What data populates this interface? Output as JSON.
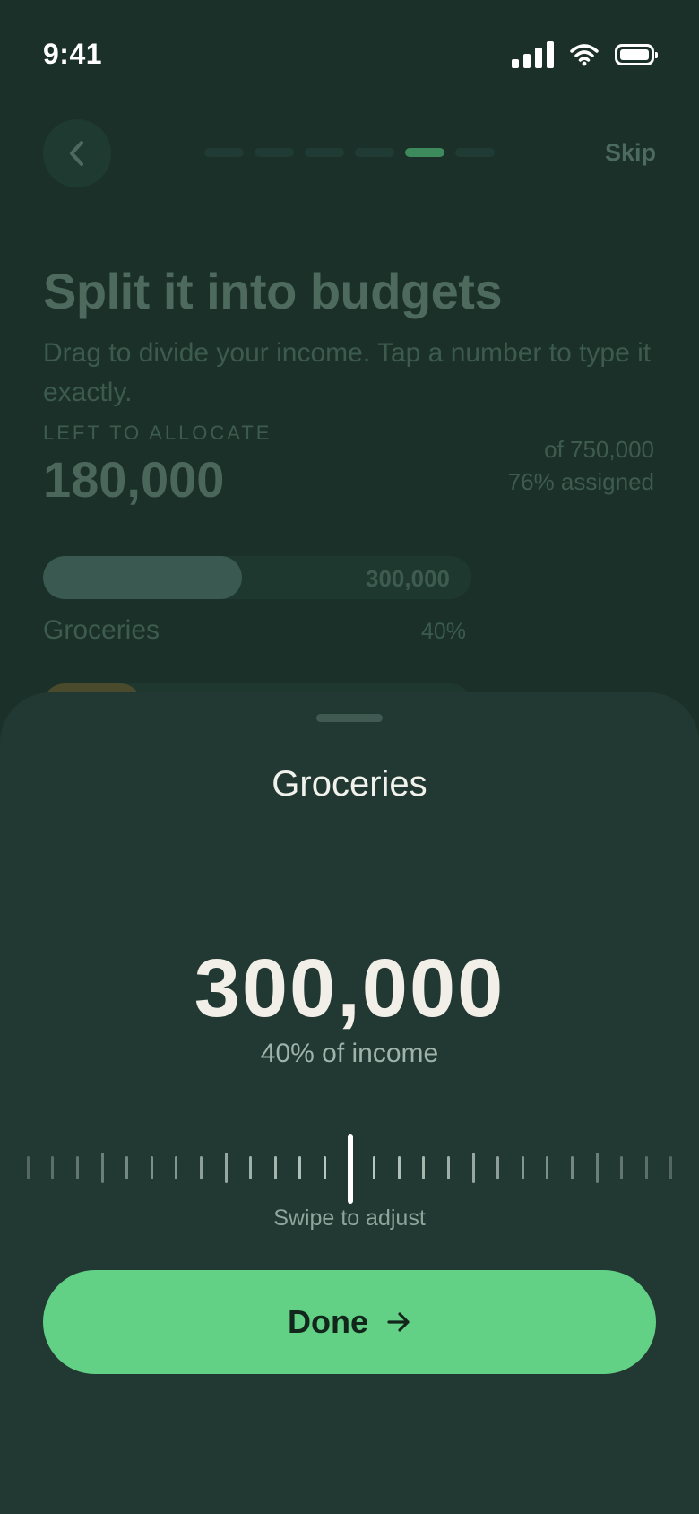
{
  "status_bar": {
    "time": "9:41"
  },
  "header": {
    "skip_label": "Skip",
    "progress_total": 6,
    "progress_current": 5
  },
  "page": {
    "title": "Split it into budgets",
    "subtitle": "Drag to divide your income. Tap a number to type it exactly.",
    "left_label": "LEFT TO ALLOCATE",
    "left_amount": "180,000",
    "of_total": "of 750,000",
    "assigned": "76% assigned"
  },
  "budgets": [
    {
      "name": "Groceries",
      "amount": "300,000",
      "percent_label": "40%",
      "fill_fraction": 0.465
    }
  ],
  "sheet": {
    "title": "Groceries",
    "amount": "300,000",
    "percent_label": "40% of income",
    "hint": "Swipe to adjust",
    "done_label": "Done"
  },
  "colors": {
    "accent": "#62d186",
    "background": "#1b3028",
    "sheet": "#213932",
    "progress_active": "#3d8a5c"
  }
}
